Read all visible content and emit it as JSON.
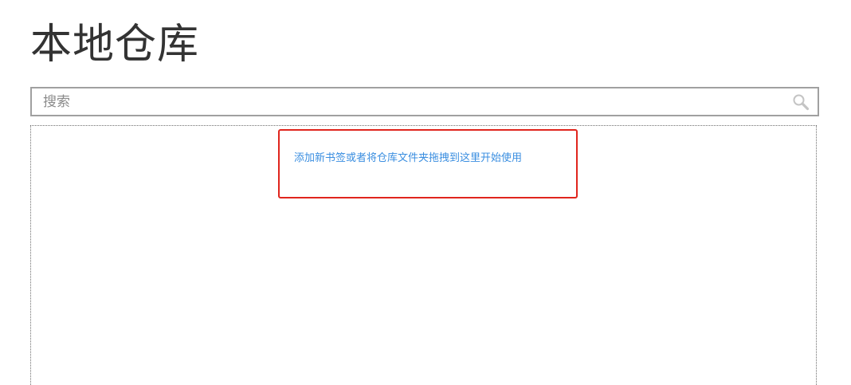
{
  "page": {
    "title": "本地仓库"
  },
  "search": {
    "placeholder": "搜索",
    "value": "",
    "icon": "search-icon"
  },
  "drop_area": {
    "hint": "添加新书签或者将仓库文件夹拖拽到这里开始使用"
  },
  "colors": {
    "title_text": "#333333",
    "hint_text": "#3a8ee0",
    "highlight_border": "#e0251d",
    "search_border": "#a0a0a0"
  }
}
